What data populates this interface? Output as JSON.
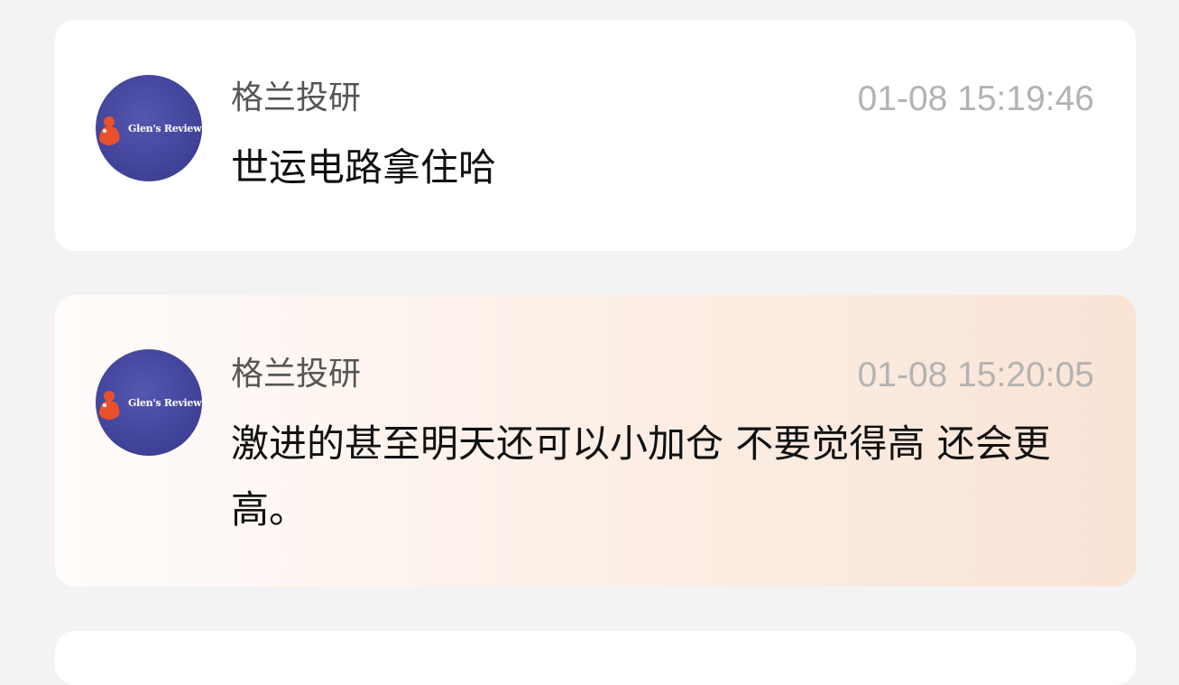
{
  "messages": [
    {
      "author": "格兰投研",
      "avatar_label": "Glen's Review",
      "timestamp": "01-08 15:19:46",
      "text": "世运电路拿住哈"
    },
    {
      "author": "格兰投研",
      "avatar_label": "Glen's Review",
      "timestamp": "01-08 15:20:05",
      "text": "激进的甚至明天还可以小加仓 不要觉得高 还会更高。"
    }
  ],
  "colors": {
    "page_background": "#f3f3f3",
    "card_background": "#ffffff",
    "highlight_gradient_end": "#f9e4d6",
    "avatar_blue": "#3f4197",
    "avatar_icon": "#e8512a",
    "timestamp_gray": "#b3b3b3"
  }
}
